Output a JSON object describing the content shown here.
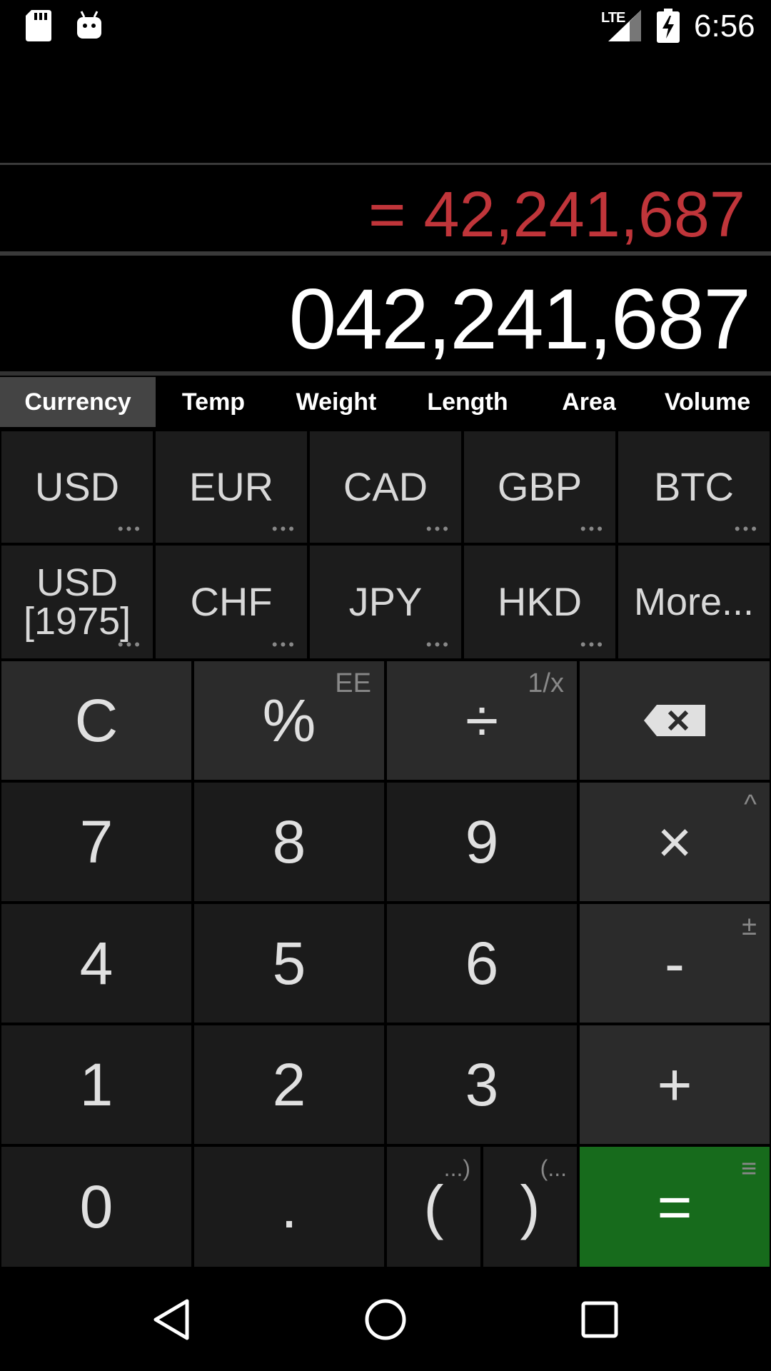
{
  "status_bar": {
    "time": "6:56",
    "network": "LTE",
    "icons": [
      "sd-card-icon",
      "android-debug-icon",
      "signal-icon",
      "battery-charging-icon"
    ]
  },
  "display": {
    "result": "= 42,241,687",
    "expression": "042,241,687"
  },
  "tabs": [
    {
      "label": "Currency",
      "active": true
    },
    {
      "label": "Temp",
      "active": false
    },
    {
      "label": "Weight",
      "active": false
    },
    {
      "label": "Length",
      "active": false
    },
    {
      "label": "Area",
      "active": false
    },
    {
      "label": "Volume",
      "active": false
    }
  ],
  "units": {
    "row1": [
      "USD",
      "EUR",
      "CAD",
      "GBP",
      "BTC"
    ],
    "row2": [
      "USD [1975]",
      "CHF",
      "JPY",
      "HKD",
      "More..."
    ],
    "dots": "•••"
  },
  "keys": {
    "clear": "C",
    "percent": "%",
    "percent_alt": "EE",
    "divide": "÷",
    "divide_alt": "1/x",
    "seven": "7",
    "eight": "8",
    "nine": "9",
    "multiply": "×",
    "multiply_alt": "^",
    "four": "4",
    "five": "5",
    "six": "6",
    "minus": "-",
    "minus_alt": "±",
    "one": "1",
    "two": "2",
    "three": "3",
    "plus": "+",
    "zero": "0",
    "dot": ".",
    "open_paren": "(",
    "open_paren_alt": "...)",
    "close_paren": ")",
    "close_paren_alt": "(...",
    "equals": "=",
    "equals_alt": "≡"
  },
  "colors": {
    "result": "#c0353a",
    "equals_key": "#176b1c",
    "active_tab": "#444444"
  }
}
